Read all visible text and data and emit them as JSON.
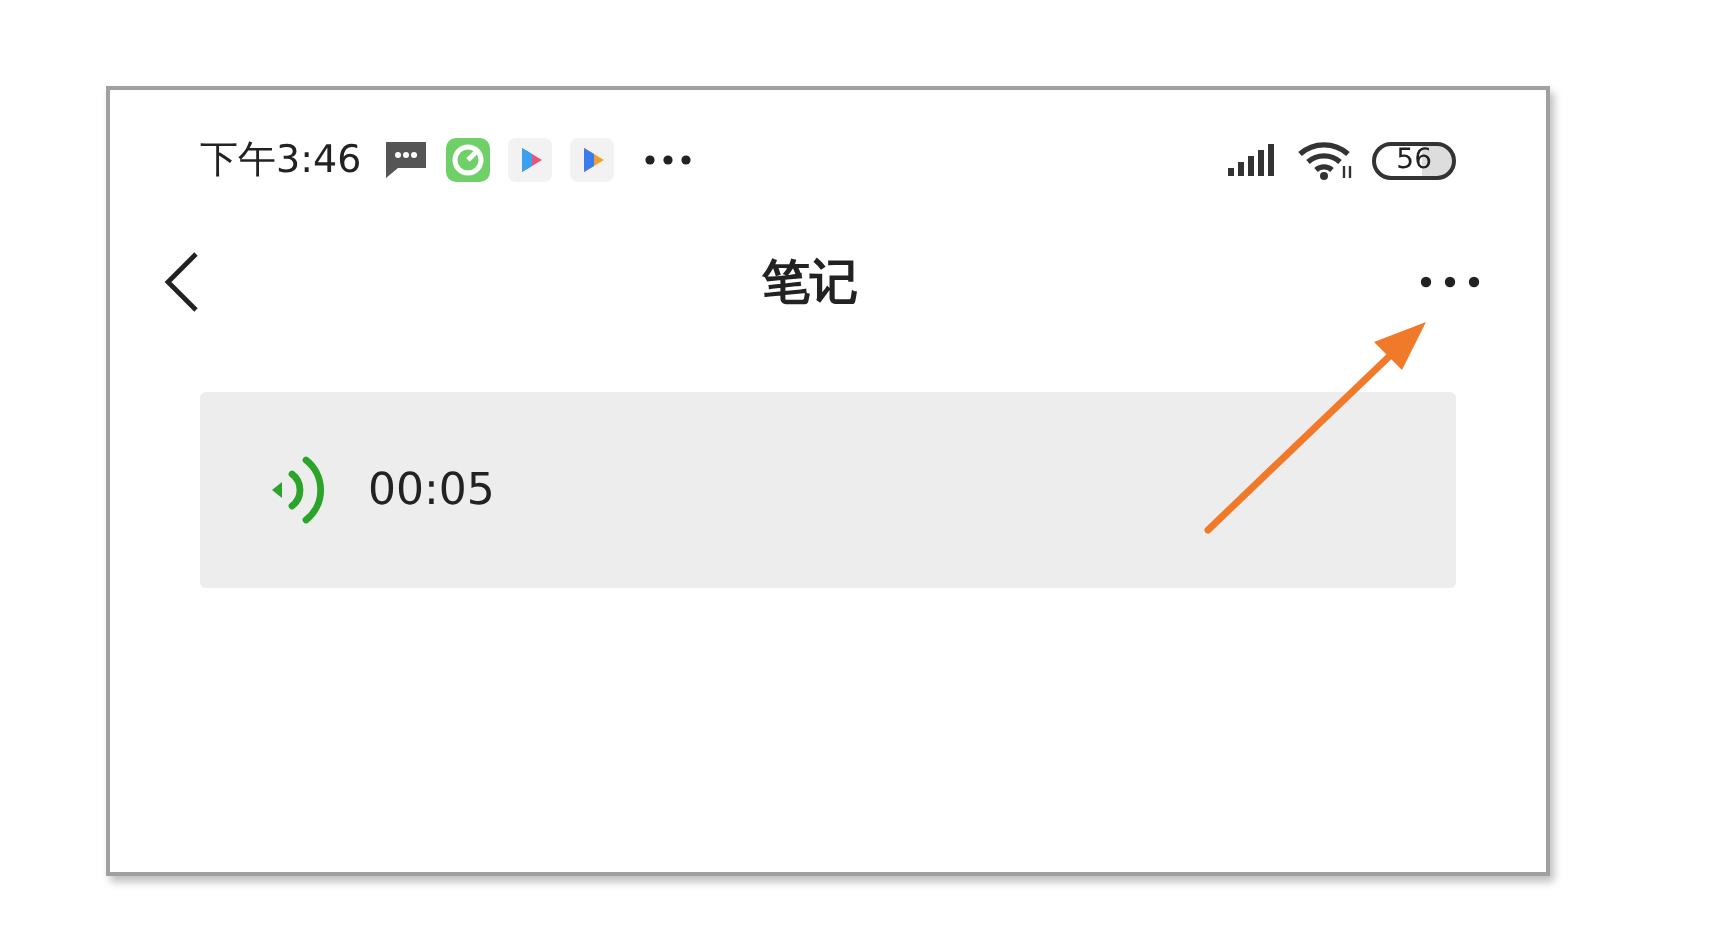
{
  "status_bar": {
    "time": "下午3:46",
    "battery": "56"
  },
  "nav": {
    "title": "笔记"
  },
  "voice_note": {
    "duration": "00:05"
  }
}
